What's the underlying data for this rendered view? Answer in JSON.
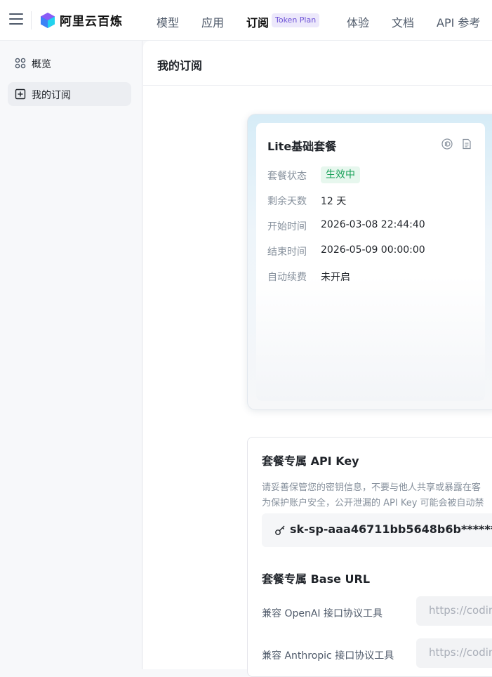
{
  "brand": {
    "name": "阿里云百炼"
  },
  "nav": {
    "items": [
      "模型",
      "应用",
      "订阅",
      "体验",
      "文档",
      "API 参考"
    ],
    "active_badge": "Token Plan"
  },
  "sidebar": {
    "items": [
      {
        "label": "概览",
        "icon": "overview-grid-icon"
      },
      {
        "label": "我的订阅",
        "icon": "subscription-icon"
      }
    ]
  },
  "main": {
    "title": "我的订阅"
  },
  "plan": {
    "name": "Lite基础套餐",
    "rows": [
      {
        "label": "套餐状态",
        "value": "生效中"
      },
      {
        "label": "剩余天数",
        "value": "12 天"
      },
      {
        "label": "开始时间",
        "value": "2026-03-08 22:44:40"
      },
      {
        "label": "结束时间",
        "value": "2026-05-09 00:00:00"
      },
      {
        "label": "自动续费",
        "value": "未开启"
      }
    ],
    "status_color": "#18a058"
  },
  "api_key": {
    "title": "套餐专属 API Key",
    "desc_line1": "请妥善保管您的密钥信息，不要与他人共享或暴露在客",
    "desc_line2": "为保护账户安全，公开泄漏的 API Key 可能会被自动禁",
    "value": "sk-sp-aaa46711bb5648b6b*********"
  },
  "base_url": {
    "title": "套餐专属 Base URL",
    "rows": [
      {
        "label": "兼容 OpenAI 接口协议工具",
        "url": "https://codin"
      },
      {
        "label": "兼容 Anthropic 接口协议工具",
        "url": "https://codin"
      }
    ]
  }
}
